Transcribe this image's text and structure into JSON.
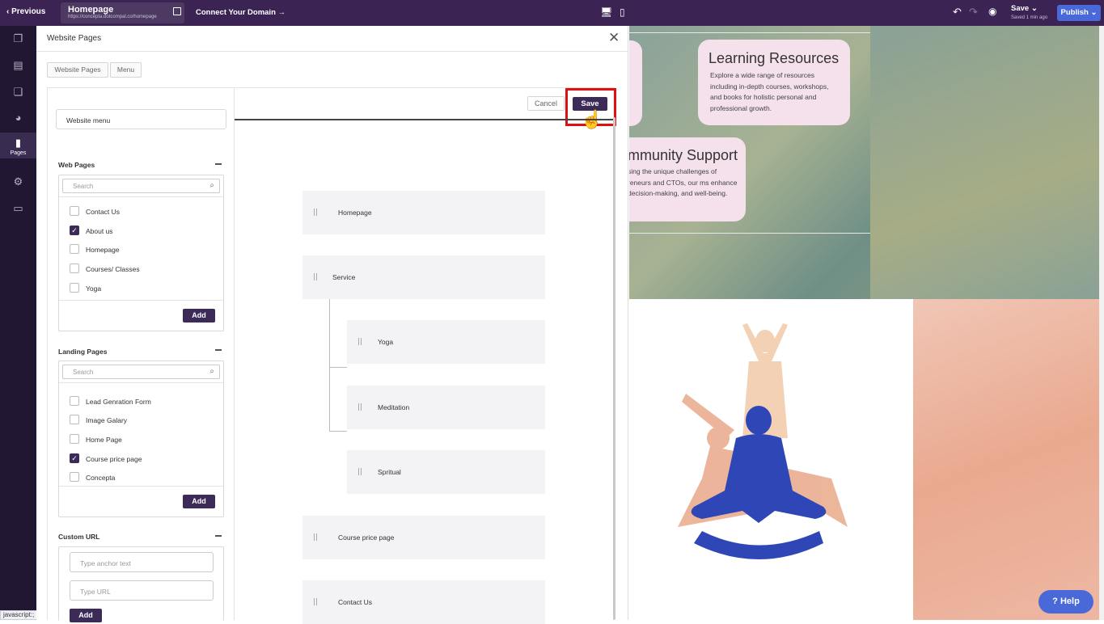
{
  "topbar": {
    "previous": "Previous",
    "page_title": "Homepage",
    "page_url": "https://concepta.dotcompal.co/homepage",
    "connect_domain": "Connect Your Domain",
    "save": "Save",
    "saved_status": "Saved 1 min ago",
    "publish": "Publish"
  },
  "sidebar": {
    "pages_label": "Pages"
  },
  "status_tip": "javascript:;",
  "panel": {
    "title": "Website Pages",
    "tabs": [
      "Website Pages",
      "Menu"
    ],
    "menu_name_value": "Website menu",
    "web_pages": {
      "heading": "Web Pages",
      "search_placeholder": "Search",
      "items": [
        {
          "label": "Contact Us",
          "checked": false
        },
        {
          "label": "About us",
          "checked": true
        },
        {
          "label": "Homepage",
          "checked": false
        },
        {
          "label": "Courses/ Classes",
          "checked": false
        },
        {
          "label": "Yoga",
          "checked": false
        }
      ],
      "add": "Add"
    },
    "landing_pages": {
      "heading": "Landing Pages",
      "search_placeholder": "Search",
      "items": [
        {
          "label": "Lead Genration Form",
          "checked": false
        },
        {
          "label": "Image Galary",
          "checked": false
        },
        {
          "label": "Home Page",
          "checked": false
        },
        {
          "label": "Course price page",
          "checked": true
        },
        {
          "label": "Concepta",
          "checked": false
        }
      ],
      "add": "Add"
    },
    "custom_url": {
      "heading": "Custom URL",
      "anchor_placeholder": "Type anchor text",
      "url_placeholder": "Type URL",
      "add": "Add"
    },
    "menu_editor": {
      "cancel": "Cancel",
      "save": "Save",
      "items": [
        "Homepage",
        "Service",
        "Yoga",
        "Meditation",
        "Spritual",
        "Course price page",
        "Contact Us"
      ]
    }
  },
  "preview": {
    "card1": {
      "title": "Learning Resources",
      "body": "Explore a wide range of resources including in-depth courses, workshops, and books for holistic personal and professional growth."
    },
    "card2": {
      "title": "mmunity Support",
      "body": "sing the unique challenges of reneurs and CTOs, our ms enhance decision-making, and well-being."
    }
  },
  "help": "Help"
}
